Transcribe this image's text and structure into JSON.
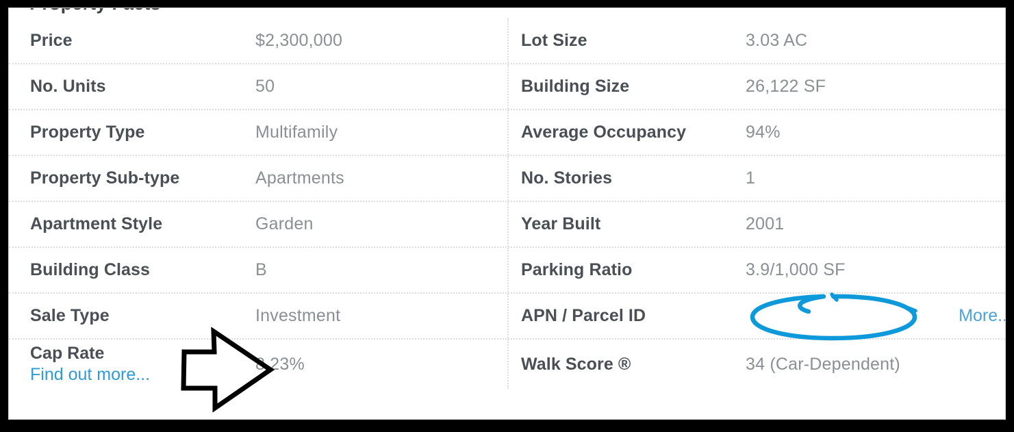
{
  "section": {
    "title": "Property Facts"
  },
  "colors": {
    "label": "#4a4f54",
    "value": "#8a8f94",
    "link": "#2e9bd6",
    "annotation_blue": "#0e9ada",
    "annotation_black": "#000000",
    "separator": "#dcdcdc"
  },
  "rows": [
    {
      "left": {
        "label": "Price",
        "value": "$2,300,000"
      },
      "right": {
        "label": "Lot Size",
        "value": "3.03 AC"
      }
    },
    {
      "left": {
        "label": "No. Units",
        "value": "50"
      },
      "right": {
        "label": "Building Size",
        "value": "26,122 SF"
      }
    },
    {
      "left": {
        "label": "Property Type",
        "value": "Multifamily"
      },
      "right": {
        "label": "Average Occupancy",
        "value": "94%"
      }
    },
    {
      "left": {
        "label": "Property Sub-type",
        "value": "Apartments"
      },
      "right": {
        "label": "No. Stories",
        "value": "1"
      }
    },
    {
      "left": {
        "label": "Apartment Style",
        "value": "Garden"
      },
      "right": {
        "label": "Year Built",
        "value": "2001"
      }
    },
    {
      "left": {
        "label": "Building Class",
        "value": "B"
      },
      "right": {
        "label": "Parking Ratio",
        "value": "3.9/1,000 SF"
      }
    },
    {
      "left": {
        "label": "Sale Type",
        "value": "Investment"
      },
      "right": {
        "label": "APN / Parcel ID",
        "value": "",
        "more_label": "More.."
      }
    },
    {
      "left": {
        "label": "Cap Rate",
        "value": "8.23%",
        "sub_link": "Find out more..."
      },
      "right": {
        "label": "Walk Score ®",
        "value": "34 (Car-Dependent)"
      }
    }
  ],
  "annotations": {
    "arrow": {
      "name": "hand-drawn block arrow pointing right",
      "points_at": "8.23%",
      "color": "#000000"
    },
    "ellipse": {
      "name": "hand-drawn blue ellipse",
      "circles": "APN / Parcel ID value (empty)",
      "color": "#0e9ada"
    }
  }
}
